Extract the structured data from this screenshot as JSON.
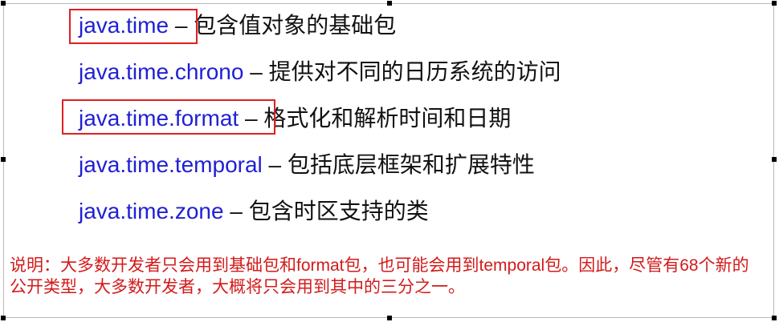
{
  "lines": [
    {
      "pkg": "java.time",
      "dash": " – ",
      "desc": "包含值对象的基础包"
    },
    {
      "pkg": "java.time.chrono",
      "dash": " – ",
      "desc": "提供对不同的日历系统的访问"
    },
    {
      "pkg": "java.time.format",
      "dash": " – ",
      "desc": "格式化和解析时间和日期"
    },
    {
      "pkg": "java.time.temporal",
      "dash": " – ",
      "desc": "包括底层框架和扩展特性"
    },
    {
      "pkg": "java.time.zone",
      "dash": " – ",
      "desc": "包含时区支持的类"
    }
  ],
  "note": "说明：大多数开发者只会用到基础包和format包，也可能会用到temporal包。因此，尽管有68个新的公开类型，大多数开发者，大概将只会用到其中的三分之一。",
  "colors": {
    "package": "#1f1fd6",
    "highlight_box": "#e02020",
    "note_text": "#d31a1a"
  }
}
